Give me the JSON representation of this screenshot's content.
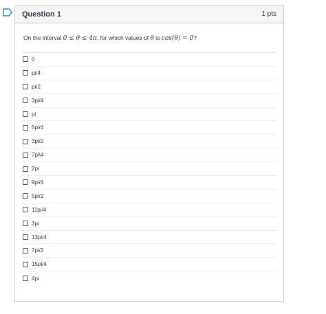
{
  "question": {
    "title": "Question 1",
    "points": "1 pts",
    "prompt_before": "On the interval ",
    "prompt_math_interval": "0 ≤ θ ≤ 4π",
    "prompt_middle": ", for which values of ",
    "prompt_math_theta": "θ",
    "prompt_is": " is ",
    "prompt_math_eq": "cos(θ) = 0",
    "prompt_end": "?"
  },
  "answers": [
    "0",
    "pi/4",
    "pi/2",
    "3pi/4",
    "pi",
    "5pi/4",
    "3pi/2",
    "7pi\\4",
    "2pi",
    "9pi/4",
    "5pi/2",
    "11pi/4",
    "3pi",
    "13pi/4",
    "7pi/2",
    "15pi/4",
    "4pi"
  ],
  "colors": {
    "flag": "#0374b5",
    "header_bg": "#f5f5f5",
    "border": "#c7cdd1"
  },
  "icons": {
    "flag": "bookmark-flag-icon",
    "checkbox": "checkbox-icon"
  }
}
